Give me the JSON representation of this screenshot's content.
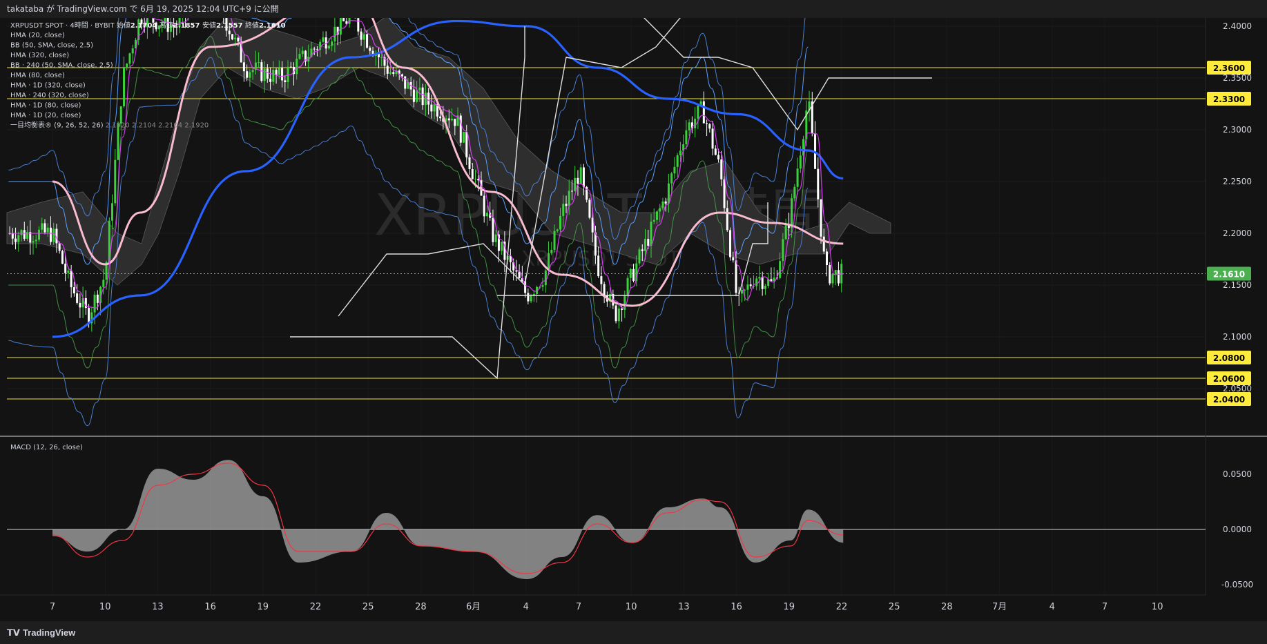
{
  "header": {
    "publish_line": "takataba が TradingView.com で 6月 19, 2025 12:04 UTC+9 に公開"
  },
  "watermark": {
    "main": "XRPUSDT, 4時間",
    "sub": "XRPUSDT SPOT"
  },
  "legend": {
    "main_line": "XRPUSDT SPOT · 4時間 · BYBIT",
    "ohlc": [
      {
        "label": "始値",
        "value": "2.1704"
      },
      {
        "label": "高値",
        "value": "2.1857"
      },
      {
        "label": "安値",
        "value": "2.1557"
      },
      {
        "label": "終値",
        "value": "2.1610"
      }
    ],
    "indicators": [
      "HMA (20, close)",
      "BB (50, SMA, close, 2.5)",
      "HMA (320, close)",
      "BB · 240 (50, SMA, close, 2.5)",
      "HMA (80, close)",
      "HMA · 1D (320, close)",
      "HMA · 240 (320, close)",
      "HMA · 1D (80, close)",
      "HMA · 1D (20, close)"
    ],
    "ichimoku_label": "一目均衡表® (9, 26, 52, 26)",
    "ichimoku_values": [
      "2.1920",
      "2.2104",
      "2.2104",
      "2.1920"
    ],
    "macd_label": "MACD (12, 26, close)"
  },
  "price_axis": {
    "ticks": [
      "2.4000",
      "2.3500",
      "2.3000",
      "2.2500",
      "2.2000",
      "2.1500",
      "2.1000",
      "2.0500"
    ]
  },
  "horizontal_levels": [
    {
      "value": "2.3600",
      "price": 2.36
    },
    {
      "value": "2.3300",
      "price": 2.33
    },
    {
      "value": "2.0800",
      "price": 2.08
    },
    {
      "value": "2.0600",
      "price": 2.06
    },
    {
      "value": "2.0400",
      "price": 2.04
    }
  ],
  "current_price": {
    "value": "2.1610",
    "price": 2.161
  },
  "macd_axis": {
    "ticks": [
      "0.0500",
      "0.0000",
      "-0.0500"
    ]
  },
  "time_axis": {
    "labels": [
      "7",
      "10",
      "13",
      "16",
      "19",
      "22",
      "25",
      "28",
      "6月",
      "4",
      "7",
      "10",
      "13",
      "16",
      "19",
      "22",
      "25",
      "28",
      "7月",
      "4",
      "7",
      "10"
    ]
  },
  "footer": {
    "brand": "TradingView"
  },
  "colors": {
    "background": "#131313",
    "up_candle": "#3bd13b",
    "down_candle": "#ffffff",
    "hma320": "#2962ff",
    "hma80_pink": "#f8bbd0",
    "level_line": "#f2e33a",
    "level_label_bg": "#ffeb3b",
    "current_label_bg": "#4caf50",
    "macd_hist": "#a8a8a8",
    "macd_signal": "#f23645"
  },
  "chart_data": {
    "type": "candlestick",
    "symbol": "XRPUSDT SPOT",
    "timeframe": "4時間",
    "ylim": [
      2.0,
      2.41
    ],
    "close_path": [
      {
        "x": "5/5",
        "y": 2.2
      },
      {
        "x": "5/6",
        "y": 2.15
      },
      {
        "x": "5/7",
        "y": 2.12
      },
      {
        "x": "5/8",
        "y": 2.16
      },
      {
        "x": "5/9",
        "y": 2.35
      },
      {
        "x": "5/10",
        "y": 2.41
      },
      {
        "x": "5/12",
        "y": 2.4
      },
      {
        "x": "5/14",
        "y": 2.44
      },
      {
        "x": "5/16",
        "y": 2.36
      },
      {
        "x": "5/18",
        "y": 2.35
      },
      {
        "x": "5/20",
        "y": 2.38
      },
      {
        "x": "5/22",
        "y": 2.41
      },
      {
        "x": "5/24",
        "y": 2.36
      },
      {
        "x": "5/26",
        "y": 2.33
      },
      {
        "x": "5/28",
        "y": 2.31
      },
      {
        "x": "5/30",
        "y": 2.2
      },
      {
        "x": "6/1",
        "y": 2.14
      },
      {
        "x": "6/2",
        "y": 2.16
      },
      {
        "x": "6/3",
        "y": 2.22
      },
      {
        "x": "6/4",
        "y": 2.26
      },
      {
        "x": "6/5",
        "y": 2.17
      },
      {
        "x": "6/6",
        "y": 2.12
      },
      {
        "x": "6/7",
        "y": 2.16
      },
      {
        "x": "6/9",
        "y": 2.24
      },
      {
        "x": "6/10",
        "y": 2.3
      },
      {
        "x": "6/11",
        "y": 2.32
      },
      {
        "x": "6/12",
        "y": 2.26
      },
      {
        "x": "6/13",
        "y": 2.13
      },
      {
        "x": "6/14",
        "y": 2.16
      },
      {
        "x": "6/15",
        "y": 2.15
      },
      {
        "x": "6/16",
        "y": 2.22
      },
      {
        "x": "6/17",
        "y": 2.33
      },
      {
        "x": "6/18",
        "y": 2.16
      },
      {
        "x": "6/19",
        "y": 2.161
      }
    ],
    "last_bar": {
      "open": 2.1704,
      "high": 2.1857,
      "low": 2.1557,
      "close": 2.161
    },
    "hma_320": [
      {
        "x": "5/5",
        "y": 2.1
      },
      {
        "x": "5/10",
        "y": 2.14
      },
      {
        "x": "5/16",
        "y": 2.26
      },
      {
        "x": "5/22",
        "y": 2.37
      },
      {
        "x": "5/28",
        "y": 2.405
      },
      {
        "x": "6/1",
        "y": 2.4
      },
      {
        "x": "6/5",
        "y": 2.36
      },
      {
        "x": "6/9",
        "y": 2.33
      },
      {
        "x": "6/13",
        "y": 2.315
      },
      {
        "x": "6/17",
        "y": 2.28
      },
      {
        "x": "6/19",
        "y": 2.253
      }
    ],
    "hma_80_1d": [
      {
        "x": "5/5",
        "y": 2.25
      },
      {
        "x": "5/8",
        "y": 2.17
      },
      {
        "x": "5/10",
        "y": 2.22
      },
      {
        "x": "5/14",
        "y": 2.38
      },
      {
        "x": "5/22",
        "y": 2.43
      },
      {
        "x": "5/25",
        "y": 2.36
      },
      {
        "x": "5/30",
        "y": 2.24
      },
      {
        "x": "6/3",
        "y": 2.16
      },
      {
        "x": "6/7",
        "y": 2.13
      },
      {
        "x": "6/12",
        "y": 2.22
      },
      {
        "x": "6/15",
        "y": 2.21
      },
      {
        "x": "6/19",
        "y": 2.19
      }
    ],
    "projection_line": [
      {
        "x": "6/19",
        "y": 2.206
      },
      {
        "x": "6/20",
        "y": 2.205
      },
      {
        "x": "6/22",
        "y": 2.205
      },
      {
        "x": "6/23",
        "y": 2.205
      },
      {
        "x": "7/5",
        "y": 2.206
      }
    ],
    "macd": {
      "ylim": [
        -0.06,
        0.07
      ],
      "histogram": [
        {
          "x": "5/5",
          "y": -0.006
        },
        {
          "x": "5/7",
          "y": -0.02
        },
        {
          "x": "5/9",
          "y": 0.0
        },
        {
          "x": "5/11",
          "y": 0.055
        },
        {
          "x": "5/13",
          "y": 0.045
        },
        {
          "x": "5/15",
          "y": 0.063
        },
        {
          "x": "5/17",
          "y": 0.03
        },
        {
          "x": "5/19",
          "y": -0.03
        },
        {
          "x": "5/22",
          "y": -0.02
        },
        {
          "x": "5/24",
          "y": 0.015
        },
        {
          "x": "5/26",
          "y": -0.015
        },
        {
          "x": "5/29",
          "y": -0.02
        },
        {
          "x": "6/1",
          "y": -0.045
        },
        {
          "x": "6/3",
          "y": -0.025
        },
        {
          "x": "6/5",
          "y": 0.013
        },
        {
          "x": "6/7",
          "y": -0.012
        },
        {
          "x": "6/9",
          "y": 0.02
        },
        {
          "x": "6/11",
          "y": 0.028
        },
        {
          "x": "6/12",
          "y": 0.02
        },
        {
          "x": "6/14",
          "y": -0.03
        },
        {
          "x": "6/16",
          "y": -0.01
        },
        {
          "x": "6/17",
          "y": 0.018
        },
        {
          "x": "6/19",
          "y": -0.012
        }
      ],
      "signal": [
        {
          "x": "5/5",
          "y": -0.005
        },
        {
          "x": "5/7",
          "y": -0.025
        },
        {
          "x": "5/9",
          "y": -0.01
        },
        {
          "x": "5/11",
          "y": 0.04
        },
        {
          "x": "5/13",
          "y": 0.05
        },
        {
          "x": "5/15",
          "y": 0.06
        },
        {
          "x": "5/17",
          "y": 0.04
        },
        {
          "x": "5/19",
          "y": -0.02
        },
        {
          "x": "5/22",
          "y": -0.02
        },
        {
          "x": "5/24",
          "y": 0.005
        },
        {
          "x": "5/26",
          "y": -0.015
        },
        {
          "x": "5/29",
          "y": -0.02
        },
        {
          "x": "6/1",
          "y": -0.04
        },
        {
          "x": "6/3",
          "y": -0.03
        },
        {
          "x": "6/5",
          "y": 0.005
        },
        {
          "x": "6/7",
          "y": -0.012
        },
        {
          "x": "6/9",
          "y": 0.015
        },
        {
          "x": "6/11",
          "y": 0.027
        },
        {
          "x": "6/12",
          "y": 0.025
        },
        {
          "x": "6/14",
          "y": -0.025
        },
        {
          "x": "6/16",
          "y": -0.015
        },
        {
          "x": "6/17",
          "y": 0.008
        },
        {
          "x": "6/19",
          "y": -0.005
        }
      ]
    }
  }
}
